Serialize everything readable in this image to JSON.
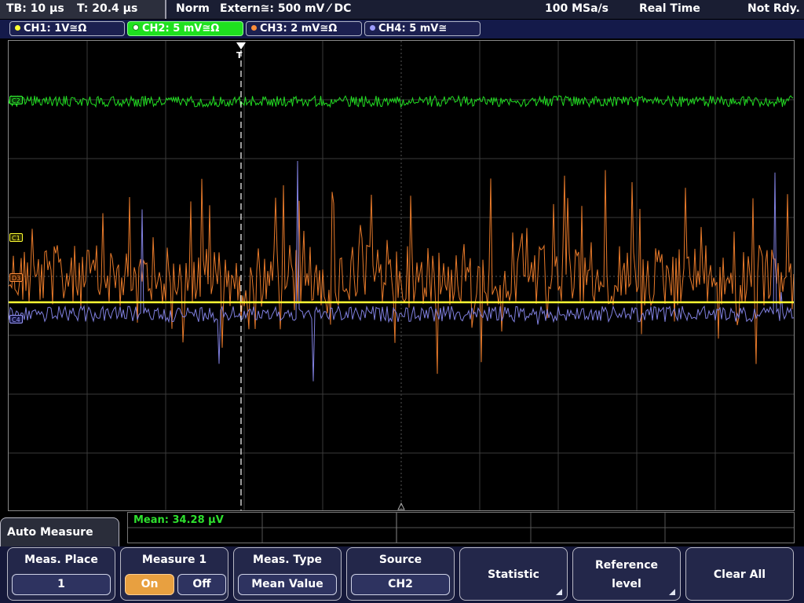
{
  "status": {
    "timebase": "TB: 10 µs",
    "trigger_time": "T: 20.4 µs",
    "mode": "Norm",
    "trigger_source": "Extern≅: 500 mV ⁄ DC",
    "sample_rate": "100 MSa/s",
    "acq_mode": "Real Time",
    "ready_state": "Not Rdy."
  },
  "channels": [
    {
      "label": "CH1: 1V≅Ω",
      "color": "#ffff33",
      "active": false
    },
    {
      "label": "CH2: 5 mV≅Ω",
      "color": "#33ff33",
      "active": true
    },
    {
      "label": "CH3: 2 mV≅Ω",
      "color": "#ff8c3a",
      "active": false
    },
    {
      "label": "CH4: 5 mV≅",
      "color": "#9c9cff",
      "active": false
    }
  ],
  "markers": {
    "c2": "C2",
    "c1": "C1",
    "c3": "D3",
    "c4": "C4",
    "trigger": "T"
  },
  "measurement": {
    "result": "Mean: 34.28 µV"
  },
  "menu": {
    "title": "Auto Measure"
  },
  "softkeys": {
    "meas_place": {
      "title": "Meas. Place",
      "value": "1"
    },
    "measure1": {
      "title": "Measure 1",
      "on": "On",
      "off": "Off",
      "state": "on"
    },
    "meas_type": {
      "title": "Meas. Type",
      "value": "Mean Value"
    },
    "source": {
      "title": "Source",
      "value": "CH2"
    },
    "statistic": {
      "label": "Statistic"
    },
    "reference": {
      "line1": "Reference",
      "line2": "level"
    },
    "clear_all": {
      "label": "Clear All"
    }
  },
  "colors": {
    "ch1": "#ffff33",
    "ch2": "#22dd22",
    "ch3": "#e87a2a",
    "ch4": "#8080e0",
    "grid": "#3a3a3a"
  }
}
